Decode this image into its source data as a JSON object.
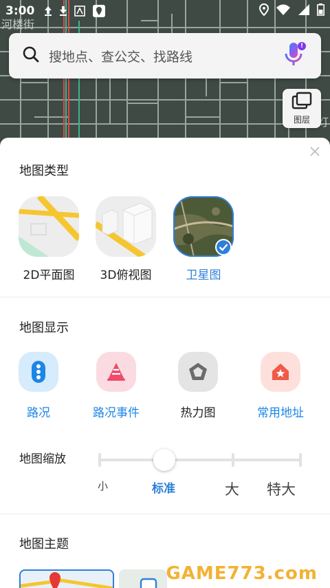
{
  "status_bar": {
    "time": "3:00"
  },
  "map": {
    "street_label": "河楼街",
    "right_label": "灯"
  },
  "search": {
    "placeholder": "搜地点、查公交、找路线",
    "mic_badge": "!"
  },
  "layers": {
    "label": "图层"
  },
  "map_type": {
    "title": "地图类型",
    "items": [
      {
        "label": "2D平面图",
        "selected": false
      },
      {
        "label": "3D俯视图",
        "selected": false
      },
      {
        "label": "卫星图",
        "selected": true
      }
    ]
  },
  "map_display": {
    "title": "地图显示",
    "items": [
      {
        "label": "路况",
        "icon": "traffic-light-icon",
        "active": true
      },
      {
        "label": "路况事件",
        "icon": "traffic-cone-icon",
        "active": true
      },
      {
        "label": "热力图",
        "icon": "pentagon-icon",
        "active": false
      },
      {
        "label": "常用地址",
        "icon": "home-star-icon",
        "active": true
      }
    ]
  },
  "zoom": {
    "label": "地图缩放",
    "options": [
      "小",
      "标准",
      "大",
      "特大"
    ],
    "selected": "标准"
  },
  "map_theme": {
    "title": "地图主题"
  },
  "watermark": {
    "text": "GAME773.com"
  },
  "colors": {
    "accent": "#2f7fd8",
    "text": "#222222"
  }
}
